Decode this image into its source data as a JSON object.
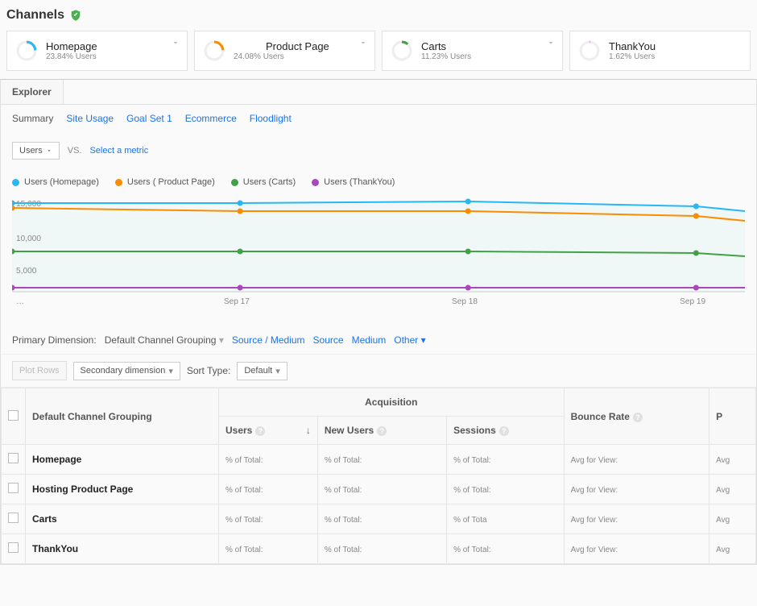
{
  "header": {
    "title": "Channels"
  },
  "cards": [
    {
      "title": "Homepage",
      "pct": "23.84% Users",
      "color": "#29b6f6"
    },
    {
      "title": "Product Page",
      "pct": "24.08% Users",
      "color": "#fb8c00",
      "titlePrefixBlur": true
    },
    {
      "title": "Carts",
      "pct": "11.23% Users",
      "color": "#43a047"
    },
    {
      "title": "ThankYou",
      "pct": "1.62% Users",
      "color": "#ab47bc"
    }
  ],
  "tabs": {
    "explorer": "Explorer"
  },
  "subtabs": {
    "summary": "Summary",
    "siteUsage": "Site Usage",
    "goalSet1": "Goal Set 1",
    "ecommerce": "Ecommerce",
    "floodlight": "Floodlight"
  },
  "metricSel": {
    "users": "Users",
    "vs": "VS.",
    "select": "Select a metric"
  },
  "legend": [
    {
      "label": "Users (Homepage)",
      "color": "#29b6f6"
    },
    {
      "label": "Users (         Product Page)",
      "color": "#fb8c00"
    },
    {
      "label": "Users (Carts)",
      "color": "#43a047"
    },
    {
      "label": "Users (ThankYou)",
      "color": "#ab47bc"
    }
  ],
  "chart_data": {
    "type": "line",
    "x": [
      "…",
      "Sep 17",
      "Sep 18",
      "Sep 19"
    ],
    "ylim": [
      0,
      15000
    ],
    "yticks": [
      5000,
      10000,
      15000
    ],
    "series": [
      {
        "name": "Users (Homepage)",
        "color": "#29b6f6",
        "values": [
          15000,
          15000,
          15200,
          14800
        ]
      },
      {
        "name": "Users (Product Page)",
        "color": "#fb8c00",
        "values": [
          14500,
          14200,
          14200,
          13600
        ]
      },
      {
        "name": "Users (Carts)",
        "color": "#43a047",
        "values": [
          7000,
          7000,
          7000,
          6800
        ]
      },
      {
        "name": "Users (ThankYou)",
        "color": "#ab47bc",
        "values": [
          1000,
          1000,
          1000,
          1000
        ]
      }
    ]
  },
  "dimRow": {
    "label": "Primary Dimension:",
    "current": "Default Channel Grouping",
    "links": {
      "sourceMedium": "Source / Medium",
      "source": "Source",
      "medium": "Medium",
      "other": "Other"
    }
  },
  "ctrl": {
    "plotRows": "Plot Rows",
    "secondary": "Secondary dimension",
    "sortType": "Sort Type:",
    "default": "Default"
  },
  "table": {
    "groupHeader": "Acquisition",
    "rowHeader": "Default Channel Grouping",
    "cols": [
      "Users",
      "New Users",
      "Sessions",
      "Bounce Rate",
      "P"
    ],
    "cellMetaPct": "% of Total:",
    "cellMetaPctShort": "% of Tota",
    "cellMetaAvg": "Avg for View:",
    "cellMetaAvgShort": "Avg",
    "rows": [
      "Homepage",
      "Hosting Product Page",
      "Carts",
      "ThankYou"
    ]
  }
}
